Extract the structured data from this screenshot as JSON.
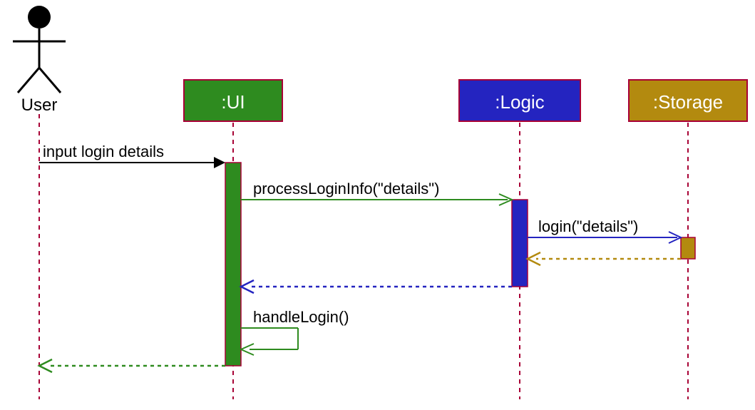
{
  "type": "sequence-diagram",
  "actor": {
    "name": "User"
  },
  "participants": {
    "ui": {
      "label": ":UI",
      "color": "#2e8b1f"
    },
    "logic": {
      "label": ":Logic",
      "color": "#2424c0"
    },
    "storage": {
      "label": ":Storage",
      "color": "#b38a0f"
    }
  },
  "messages": {
    "m1": "input login details",
    "m2": "processLoginInfo(\"details\")",
    "m3": "login(\"details\")",
    "m4": "handleLogin()"
  },
  "colors": {
    "green": "#2e8b1f",
    "blue": "#2424c0",
    "gold": "#b38a0f",
    "border": "#a80036",
    "black": "#000000"
  }
}
